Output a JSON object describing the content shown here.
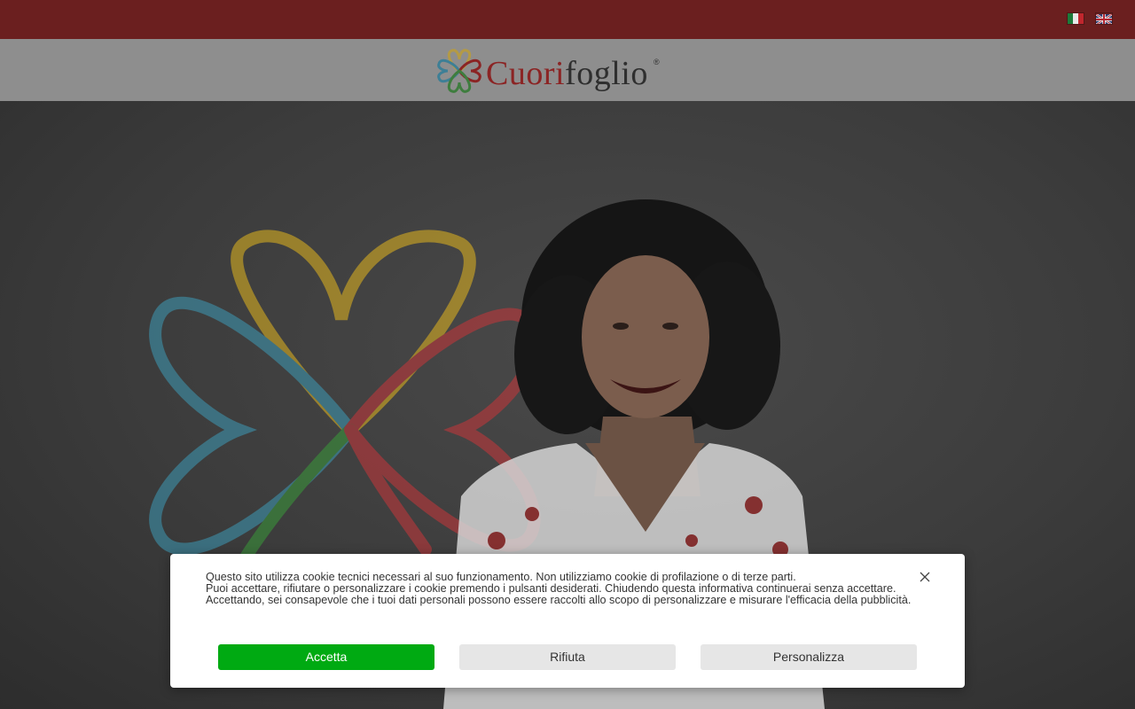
{
  "topbar": {
    "languages": [
      {
        "code": "it",
        "icon": "flag-italy-icon"
      },
      {
        "code": "en",
        "icon": "flag-uk-icon"
      }
    ]
  },
  "header": {
    "logo": {
      "text_part1": "Cuori",
      "text_part2": "foglio",
      "registered": "®"
    }
  },
  "colors": {
    "topbar": "#6b1f1f",
    "accept": "#00aa12",
    "secondary_button": "#e6e6e6",
    "brand_red": "#8b2424",
    "clover_yellow": "#e3b61e",
    "clover_blue": "#3d9ab6",
    "clover_red": "#c8363a",
    "clover_green": "#3a9a3a"
  },
  "cookie_banner": {
    "lines": [
      "Questo sito utilizza cookie tecnici necessari al suo funzionamento. Non utilizziamo cookie di profilazione o di terze parti.",
      "Puoi accettare, rifiutare o personalizzare i cookie premendo i pulsanti desiderati. Chiudendo questa informativa continuerai senza accettare.",
      "Accettando, sei consapevole che i tuoi dati personali possono essere raccolti allo scopo di personalizzare e misurare l'efficacia della pubblicità."
    ],
    "accept_label": "Accetta",
    "reject_label": "Rifiuta",
    "customize_label": "Personalizza",
    "close_icon": "close-icon"
  }
}
